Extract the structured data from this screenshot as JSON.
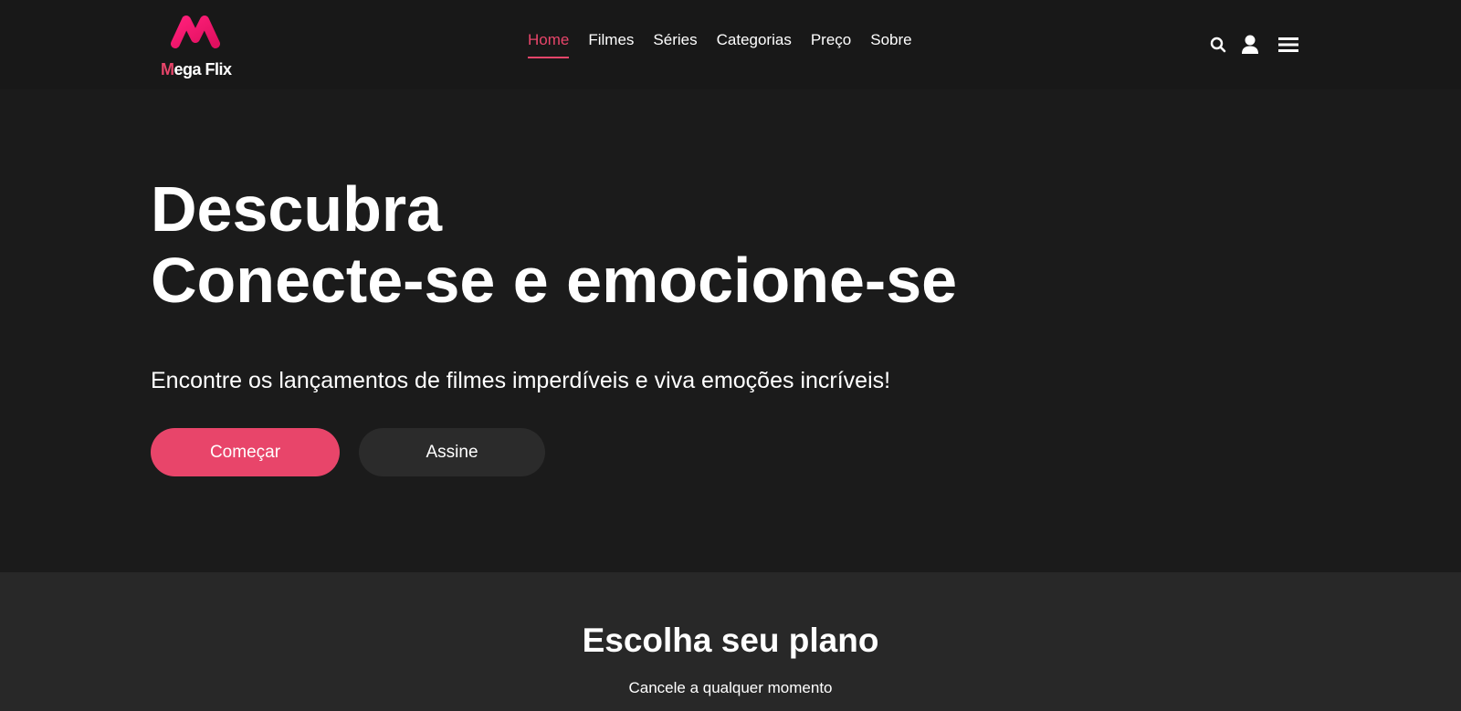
{
  "header": {
    "logo": {
      "first_letter": "M",
      "rest": "ega Flix",
      "accent_color": "#e8456a",
      "mark_color": "#ff1f7a"
    },
    "nav": [
      {
        "label": "Home",
        "active": true
      },
      {
        "label": "Filmes",
        "active": false
      },
      {
        "label": "Séries",
        "active": false
      },
      {
        "label": "Categorias",
        "active": false
      },
      {
        "label": "Preço",
        "active": false
      },
      {
        "label": "Sobre",
        "active": false
      }
    ],
    "icons": [
      "search-icon",
      "user-icon",
      "menu-icon"
    ]
  },
  "hero": {
    "title_line1": "Descubra",
    "title_line2": "Conecte-se e emocione-se",
    "subtitle": "Encontre os lançamentos de filmes imperdíveis e viva emoções incríveis!",
    "primary_button": "Começar",
    "secondary_button": "Assine"
  },
  "plans": {
    "title": "Escolha seu plano",
    "subtitle": "Cancele a qualquer momento"
  },
  "colors": {
    "accent": "#e8456a",
    "header_bg": "#181818",
    "hero_bg": "#1b1b1b",
    "section_bg": "#282828",
    "secondary_button_bg": "#2b2b2b"
  }
}
